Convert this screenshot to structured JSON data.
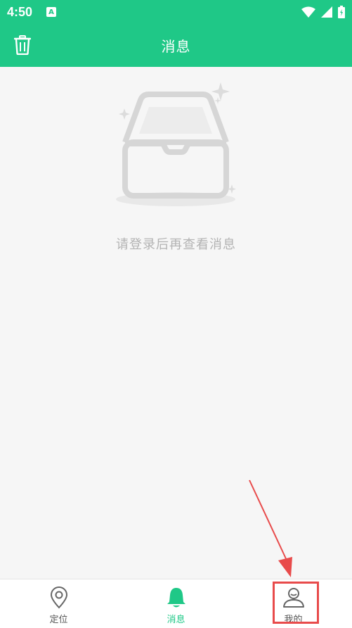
{
  "status_bar": {
    "time": "4:50",
    "notification_icon": "a-icon",
    "icons": [
      "wifi-icon",
      "signal-icon",
      "battery-icon"
    ]
  },
  "header": {
    "title": "消息",
    "left_icon": "trash-icon"
  },
  "empty_state": {
    "icon": "empty-inbox-icon",
    "message": "请登录后再查看消息"
  },
  "tab_bar": {
    "tabs": [
      {
        "label": "定位",
        "icon": "location-pin-icon",
        "active": false
      },
      {
        "label": "消息",
        "icon": "bell-icon",
        "active": true
      },
      {
        "label": "我的",
        "icon": "user-icon",
        "active": false
      }
    ]
  },
  "colors": {
    "primary": "#1fc887",
    "annotation": "#e84b4b",
    "muted_text": "#b3b3b3"
  }
}
